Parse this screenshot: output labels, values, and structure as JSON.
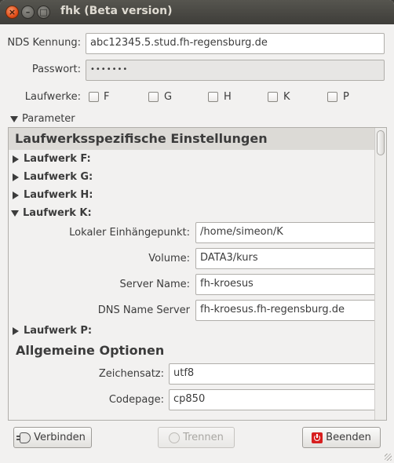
{
  "window": {
    "title": "fhk (Beta version)"
  },
  "login": {
    "nds_label": "NDS Kennung:",
    "nds_value": "abc12345.5.stud.fh-regensburg.de",
    "password_label": "Passwort:",
    "password_value": "•••••••"
  },
  "drives": {
    "label": "Laufwerke:",
    "items": [
      {
        "letter": "F",
        "checked": false
      },
      {
        "letter": "G",
        "checked": false
      },
      {
        "letter": "H",
        "checked": false
      },
      {
        "letter": "K",
        "checked": false
      },
      {
        "letter": "P",
        "checked": false
      }
    ]
  },
  "parameter": {
    "expander_label": "Parameter",
    "drive_section_title": "Laufwerksspezifische Einstellungen",
    "drive_rows": [
      {
        "label": "Laufwerk F:",
        "expanded": false
      },
      {
        "label": "Laufwerk G:",
        "expanded": false
      },
      {
        "label": "Laufwerk H:",
        "expanded": false
      },
      {
        "label": "Laufwerk K:",
        "expanded": true
      },
      {
        "label": "Laufwerk P:",
        "expanded": false
      }
    ],
    "drive_k": {
      "mount_label": "Lokaler Einhängepunkt:",
      "mount_value": "/home/simeon/K",
      "volume_label": "Volume:",
      "volume_value": "DATA3/kurs",
      "server_label": "Server Name:",
      "server_value": "fh-kroesus",
      "dns_label": "DNS Name Server",
      "dns_value": "fh-kroesus.fh-regensburg.de"
    },
    "general": {
      "title": "Allgemeine Optionen",
      "charset_label": "Zeichensatz:",
      "charset_value": "utf8",
      "codepage_label": "Codepage:",
      "codepage_value": "cp850"
    }
  },
  "buttons": {
    "connect": "Verbinden",
    "disconnect": "Trennen",
    "quit": "Beenden"
  },
  "icons": {
    "close": "close-icon",
    "minimize": "minimize-icon",
    "maximize": "maximize-icon",
    "connect": "plug-icon",
    "disconnect": "unplug-icon",
    "quit": "power-icon"
  }
}
